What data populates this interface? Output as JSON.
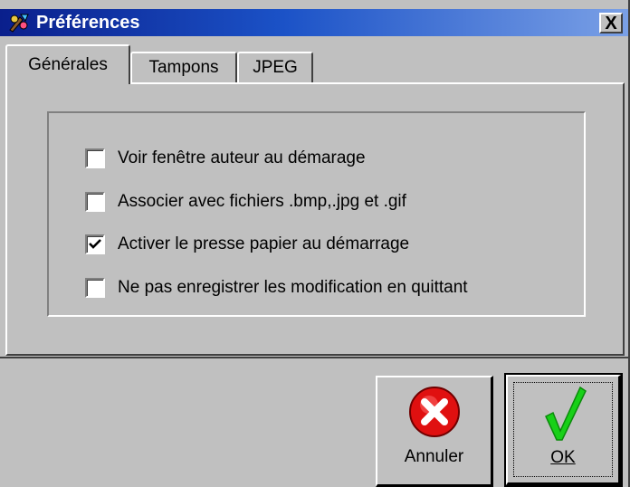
{
  "window": {
    "title": "Préférences",
    "close_label": "X"
  },
  "tabs": [
    {
      "label": "Générales",
      "active": true
    },
    {
      "label": "Tampons",
      "active": false
    },
    {
      "label": "JPEG",
      "active": false
    }
  ],
  "options": [
    {
      "label": "Voir fenêtre auteur au démarage",
      "checked": false
    },
    {
      "label": "Associer avec fichiers .bmp,.jpg et .gif",
      "checked": false
    },
    {
      "label": "Activer le presse papier au démarrage",
      "checked": true
    },
    {
      "label": "Ne pas enregistrer les modification en quittant",
      "checked": false
    }
  ],
  "buttons": {
    "cancel_label": "Annuler",
    "ok_label": "OK"
  },
  "colors": {
    "title_bar_start": "#0a1f8c",
    "cancel_icon": "#e01010",
    "ok_check": "#18d018"
  }
}
